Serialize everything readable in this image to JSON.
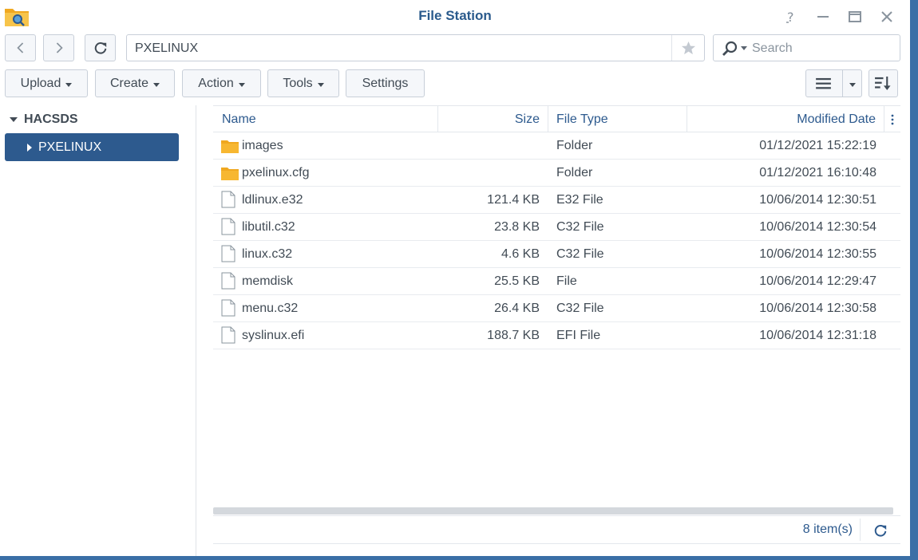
{
  "window": {
    "title": "File Station"
  },
  "nav": {
    "path": "PXELINUX",
    "search_placeholder": "Search"
  },
  "toolbar": {
    "upload": "Upload",
    "create": "Create",
    "action": "Action",
    "tools": "Tools",
    "settings": "Settings"
  },
  "tree": {
    "root": "HACSDS",
    "items": [
      {
        "label": "PXELINUX"
      }
    ]
  },
  "grid": {
    "columns": {
      "name": "Name",
      "size": "Size",
      "type": "File Type",
      "date": "Modified Date"
    },
    "rows": [
      {
        "icon": "folder-icon",
        "name": "images",
        "size": "",
        "type": "Folder",
        "date": "01/12/2021 15:22:19"
      },
      {
        "icon": "folder-icon",
        "name": "pxelinux.cfg",
        "size": "",
        "type": "Folder",
        "date": "01/12/2021 16:10:48"
      },
      {
        "icon": "file-icon",
        "name": "ldlinux.e32",
        "size": "121.4 KB",
        "type": "E32 File",
        "date": "10/06/2014 12:30:51"
      },
      {
        "icon": "file-icon",
        "name": "libutil.c32",
        "size": "23.8 KB",
        "type": "C32 File",
        "date": "10/06/2014 12:30:54"
      },
      {
        "icon": "file-icon",
        "name": "linux.c32",
        "size": "4.6 KB",
        "type": "C32 File",
        "date": "10/06/2014 12:30:55"
      },
      {
        "icon": "file-icon",
        "name": "memdisk",
        "size": "25.5 KB",
        "type": "File",
        "date": "10/06/2014 12:29:47"
      },
      {
        "icon": "file-icon",
        "name": "menu.c32",
        "size": "26.4 KB",
        "type": "C32 File",
        "date": "10/06/2014 12:30:58"
      },
      {
        "icon": "file-icon",
        "name": "syslinux.efi",
        "size": "188.7 KB",
        "type": "EFI File",
        "date": "10/06/2014 12:31:18"
      }
    ],
    "item_count": "8 item(s)"
  },
  "colors": {
    "accent": "#2d5a8e",
    "title": "#2a5a8c",
    "folder": "#f5a623"
  }
}
